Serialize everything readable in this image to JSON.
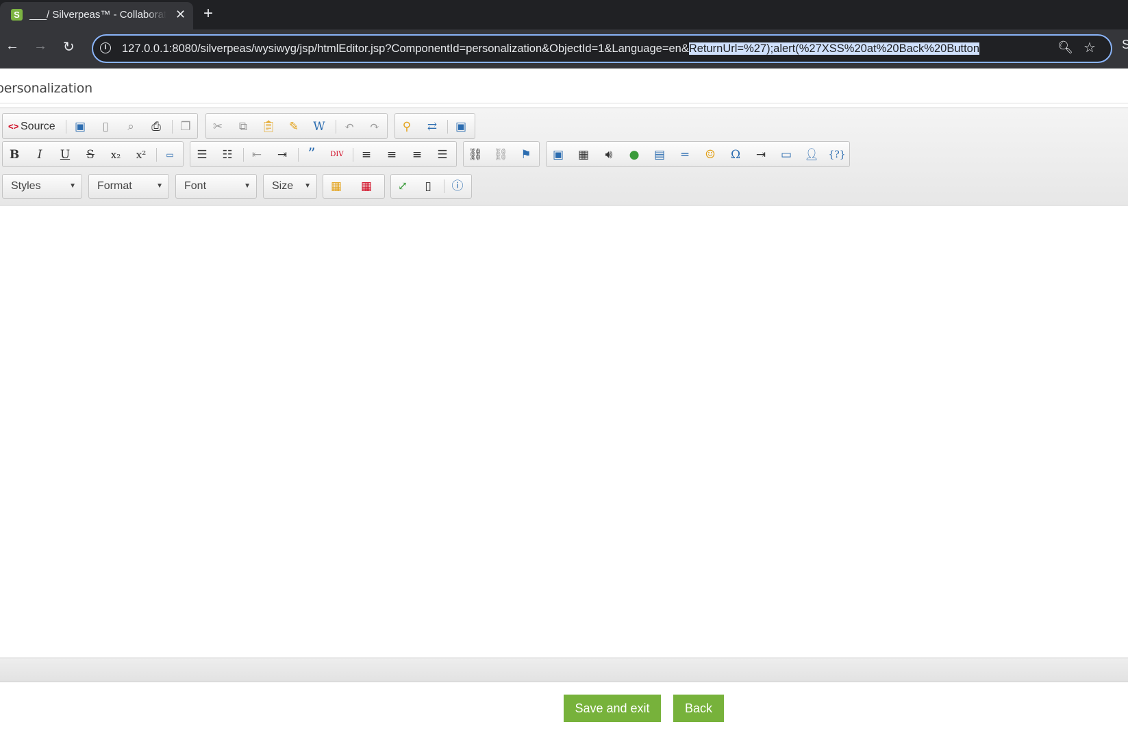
{
  "browser": {
    "tab_title": "___/ Silverpeas™ - Collaborative",
    "favicon_letter": "S",
    "url_plain": "127.0.0.1:8080/silverpeas/wysiwyg/jsp/htmlEditor.jsp?ComponentId=personalization&ObjectId=1&Language=en&",
    "url_selected": "ReturnUrl=%27);alert(%27XSS%20at%20Back%20Button"
  },
  "page": {
    "title": "personalization"
  },
  "editor": {
    "source_label": "Source",
    "combos": {
      "styles": "Styles",
      "format": "Format",
      "font": "Font",
      "size": "Size"
    }
  },
  "actions": {
    "save_exit": "Save and exit",
    "back": "Back"
  },
  "icons": [
    "back-arrow-icon",
    "forward-arrow-icon",
    "reload-icon",
    "info-icon",
    "zoom-icon",
    "star-icon",
    "save-icon",
    "new-page-icon",
    "preview-icon",
    "print-icon",
    "templates-icon",
    "cut-icon",
    "copy-icon",
    "paste-icon",
    "paste-text-icon",
    "paste-word-icon",
    "undo-icon",
    "redo-icon",
    "find-icon",
    "replace-icon",
    "select-all-icon",
    "bold-icon",
    "italic-icon",
    "underline-icon",
    "strike-icon",
    "subscript-icon",
    "superscript-icon",
    "remove-format-icon",
    "numbered-list-icon",
    "bullet-list-icon",
    "outdent-icon",
    "indent-icon",
    "blockquote-icon",
    "div-icon",
    "align-left-icon",
    "align-center-icon",
    "align-right-icon",
    "justify-icon",
    "link-icon",
    "unlink-icon",
    "anchor-icon",
    "image-icon",
    "video-icon",
    "audio-icon",
    "flash-icon",
    "table-icon",
    "horizontal-rule-icon",
    "smiley-icon",
    "special-char-icon",
    "page-break-icon",
    "iframe-icon",
    "user-icon",
    "variable-icon",
    "text-color-icon",
    "background-color-icon",
    "maximize-icon",
    "show-blocks-icon",
    "about-icon"
  ]
}
